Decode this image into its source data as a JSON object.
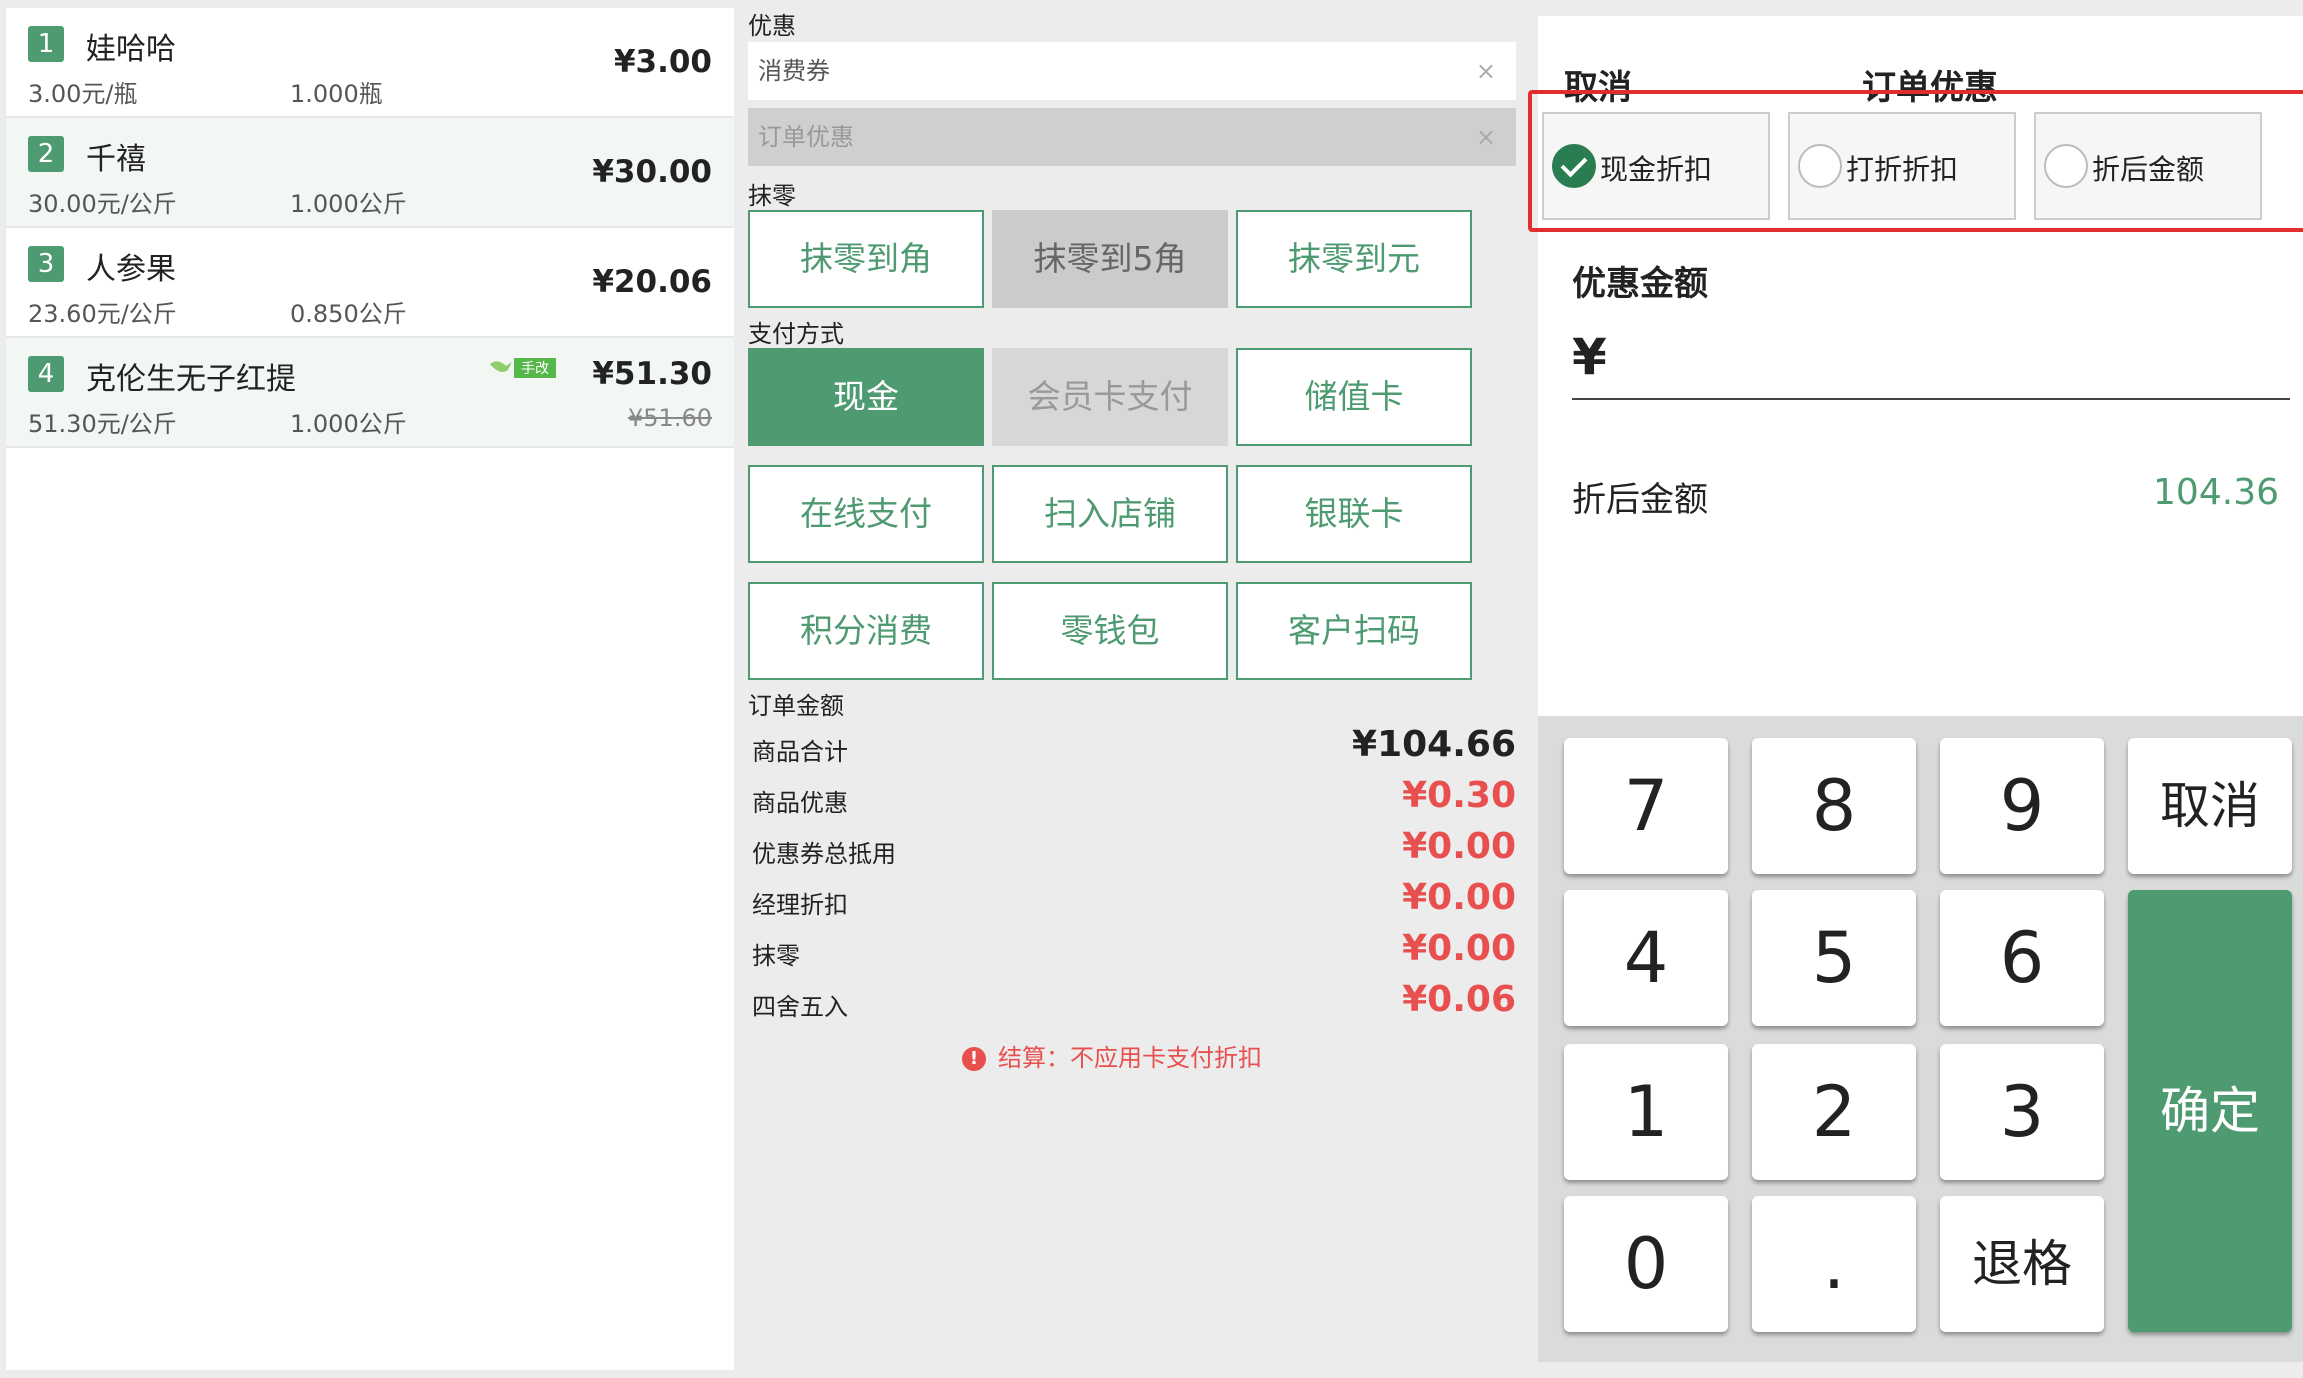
{
  "items": [
    {
      "index": "1",
      "name": "娃哈哈",
      "unit_price": "3.00元/瓶",
      "qty": "1.000瓶",
      "total": "¥3.00"
    },
    {
      "index": "2",
      "name": "千禧",
      "unit_price": "30.00元/公斤",
      "qty": "1.000公斤",
      "total": "¥30.00"
    },
    {
      "index": "3",
      "name": "人参果",
      "unit_price": "23.60元/公斤",
      "qty": "0.850公斤",
      "total": "¥20.06"
    },
    {
      "index": "4",
      "name": "克伦生无子红提",
      "unit_price": "51.30元/公斤",
      "qty": "1.000公斤",
      "total": "¥51.30",
      "original": "¥51.60",
      "tag": "手改"
    }
  ],
  "discount": {
    "label": "优惠",
    "coupon_placeholder": "消费券",
    "order_discount_placeholder": "订单优惠",
    "clear": "×"
  },
  "rounding": {
    "label": "抹零",
    "buttons": [
      "抹零到角",
      "抹零到5角",
      "抹零到元"
    ]
  },
  "payment": {
    "label": "支付方式",
    "methods": [
      "现金",
      "会员卡支付",
      "储值卡",
      "在线支付",
      "扫入店铺",
      "银联卡",
      "积分消费",
      "零钱包",
      "客户扫码"
    ]
  },
  "order_amount": {
    "label": "订单金额",
    "rows": [
      {
        "label": "商品合计",
        "value": "¥104.66"
      },
      {
        "label": "商品优惠",
        "value": "¥0.30"
      },
      {
        "label": "优惠券总抵用",
        "value": "¥0.00"
      },
      {
        "label": "经理折扣",
        "value": "¥0.00"
      },
      {
        "label": "抹零",
        "value": "¥0.00"
      },
      {
        "label": "四舍五入",
        "value": "¥0.06"
      }
    ],
    "notice_icon": "!",
    "notice": "结算：不应用卡支付折扣"
  },
  "dialog": {
    "cancel": "取消",
    "title": "订单优惠",
    "options": [
      "现金折扣",
      "打折折扣",
      "折后金额"
    ],
    "selected_option": 0,
    "discount_amount_label": "优惠金额",
    "currency": "¥",
    "after_label": "折后金额",
    "after_value": "104.36"
  },
  "keypad": {
    "digits": [
      "7",
      "8",
      "9",
      "4",
      "5",
      "6",
      "1",
      "2",
      "3",
      "0",
      "."
    ],
    "cancel": "取消",
    "backspace": "退格",
    "confirm": "确定"
  },
  "colors": {
    "accent": "#4e9a71",
    "alert": "#e8504f",
    "highlight": "#e32d2d"
  }
}
